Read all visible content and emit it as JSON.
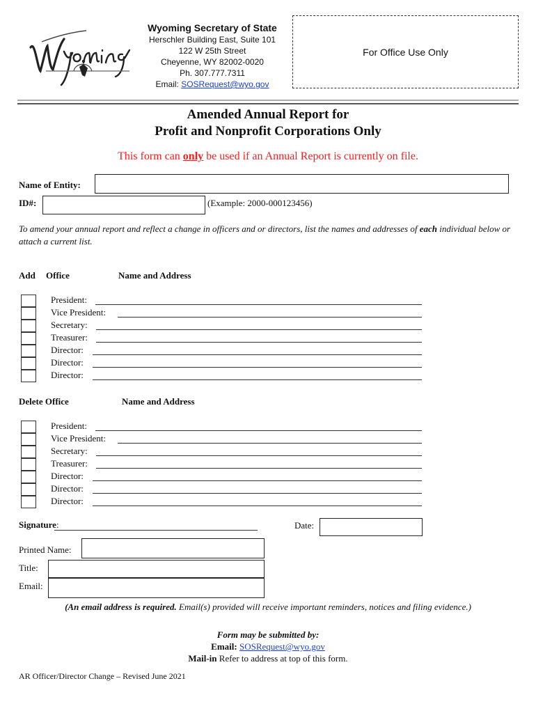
{
  "header": {
    "logo_text": "Wyoming",
    "agency_name": "Wyoming Secretary of State",
    "address_lines": [
      "Herschler Building East, Suite 101",
      "122 W 25th Street",
      "Cheyenne, WY 82002-0020",
      "Ph. 307.777.7311"
    ],
    "email_label": "Email: ",
    "email_link": "SOSRequest@wyo.gov",
    "office_use": "For Office Use Only"
  },
  "title": {
    "line1": "Amended Annual Report for",
    "line2": "Profit and Nonprofit Corporations Only"
  },
  "notice": {
    "before": "This form can ",
    "emphasis": "only",
    "after": " be used if an Annual Report is currently on file.",
    "color": "#ff1a1a"
  },
  "entity": {
    "name_label": "Name of Entity:",
    "name_value": "",
    "id_label": "ID#:",
    "id_value": "",
    "id_example": "(Example: 2000-000123456)"
  },
  "instructions": {
    "text": "To amend your annual report and reflect a change in officers and or directors, list the names and addresses of ",
    "emphasis": "each",
    "text2": " individual below or attach a current list."
  },
  "add_section": {
    "col_action": "Add",
    "col_office": "Office",
    "col_name": "Name and Address",
    "rows": [
      "President:",
      "Vice President:",
      "Secretary:",
      "Treasurer:",
      "Director:",
      "Director:",
      "Director:"
    ]
  },
  "delete_section": {
    "col_action_office": "Delete Office",
    "col_name": "Name and Address",
    "rows": [
      "President:",
      "Vice President:",
      "Secretary:",
      "Treasurer:",
      "Director:",
      "Director:",
      "Director:"
    ]
  },
  "signature": {
    "signature_label": "Signature",
    "signature_colon": ":",
    "date_label": "Date:",
    "printed_name_label": "Printed Name:",
    "title_label": "Title:",
    "email_label": "Email:"
  },
  "email_note": {
    "bold": "(An email address is required.",
    "rest": " Email(s) provided will receive important reminders, notices and filing evidence.)"
  },
  "submit": {
    "heading": "Form may be submitted by:",
    "email_label": "Email:",
    "email_link": "SOSRequest@wyo.gov",
    "mail_label": "Mail-in",
    "mail_text": " Refer to address at top of this form."
  },
  "footer": "AR Officer/Director Change – Revised June 2021",
  "colors": {
    "link": "#1a3ecf",
    "notice_red": "#ff1a1a"
  }
}
